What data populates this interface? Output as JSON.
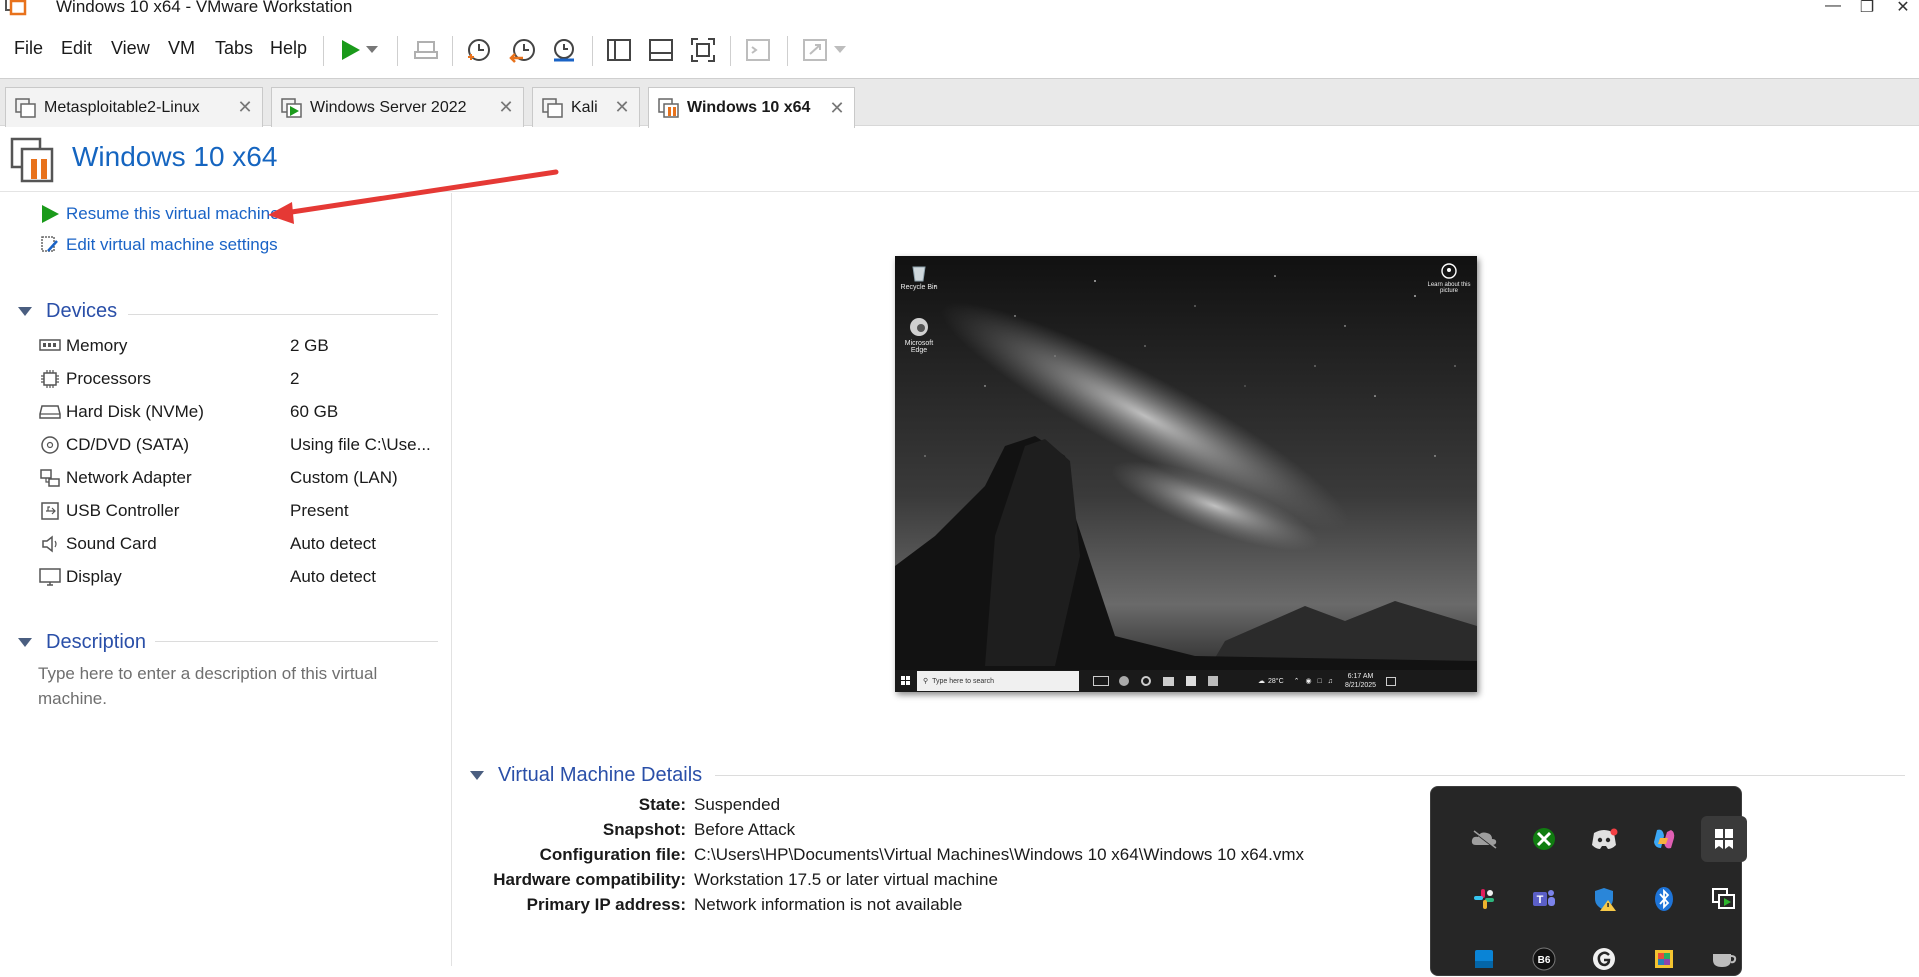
{
  "window": {
    "title": "Windows 10 x64 - VMware Workstation"
  },
  "menu": [
    "File",
    "Edit",
    "View",
    "VM",
    "Tabs",
    "Help"
  ],
  "tabs": [
    {
      "label": "Metasploitable2-Linux",
      "active": false
    },
    {
      "label": "Windows Server 2022",
      "active": false
    },
    {
      "label": "Kali",
      "active": false
    },
    {
      "label": "Windows 10 x64",
      "active": true
    }
  ],
  "vm": {
    "title": "Windows 10 x64"
  },
  "commands": {
    "resume": "Resume this virtual machine",
    "edit": "Edit virtual machine settings"
  },
  "devices": {
    "heading": "Devices",
    "items": [
      {
        "name": "Memory",
        "value": "2 GB",
        "icon": "memory-icon"
      },
      {
        "name": "Processors",
        "value": "2",
        "icon": "processor-icon"
      },
      {
        "name": "Hard Disk (NVMe)",
        "value": "60 GB",
        "icon": "hard-disk-icon"
      },
      {
        "name": "CD/DVD (SATA)",
        "value": "Using file C:\\Use...",
        "icon": "cd-dvd-icon"
      },
      {
        "name": "Network Adapter",
        "value": "Custom (LAN)",
        "icon": "network-adapter-icon"
      },
      {
        "name": "USB Controller",
        "value": "Present",
        "icon": "usb-controller-icon"
      },
      {
        "name": "Sound Card",
        "value": "Auto detect",
        "icon": "sound-card-icon"
      },
      {
        "name": "Display",
        "value": "Auto detect",
        "icon": "display-icon"
      }
    ]
  },
  "description": {
    "heading": "Description",
    "placeholder": "Type here to enter a description of this virtual machine."
  },
  "guest_screen": {
    "desktop_icons": [
      "Recycle Bin",
      "Microsoft Edge"
    ],
    "learn_label": "Learn about this picture",
    "search_placeholder": "Type here to search",
    "temperature": "28°C",
    "time": "6:17 AM",
    "date": "8/21/2025"
  },
  "details": {
    "heading": "Virtual Machine Details",
    "rows": [
      {
        "label": "State:",
        "value": "Suspended"
      },
      {
        "label": "Snapshot:",
        "value": "Before Attack"
      },
      {
        "label": "Configuration file:",
        "value": "C:\\Users\\HP\\Documents\\Virtual Machines\\Windows 10 x64\\Windows 10 x64.vmx"
      },
      {
        "label": "Hardware compatibility:",
        "value": "Workstation 17.5 or later virtual machine"
      },
      {
        "label": "Primary IP address:",
        "value": "Network information is not available"
      }
    ]
  },
  "tray_icons": [
    "onedrive-icon",
    "xbox-icon",
    "discord-icon",
    "copilot-icon",
    "bookmark-app-icon",
    "slack-icon",
    "teams-icon",
    "defender-warning-icon",
    "bluetooth-icon",
    "vmware-tray-icon",
    "blue-app-icon",
    "bo-app-icon",
    "grammarly-icon",
    "color-app-icon",
    "cup-icon"
  ],
  "colors": {
    "accent_blue": "#1565c0",
    "link_blue": "#1a63c6",
    "play_green": "#1a9a1a",
    "vmware_orange": "#e8721c",
    "annotation_red": "#e53935"
  }
}
